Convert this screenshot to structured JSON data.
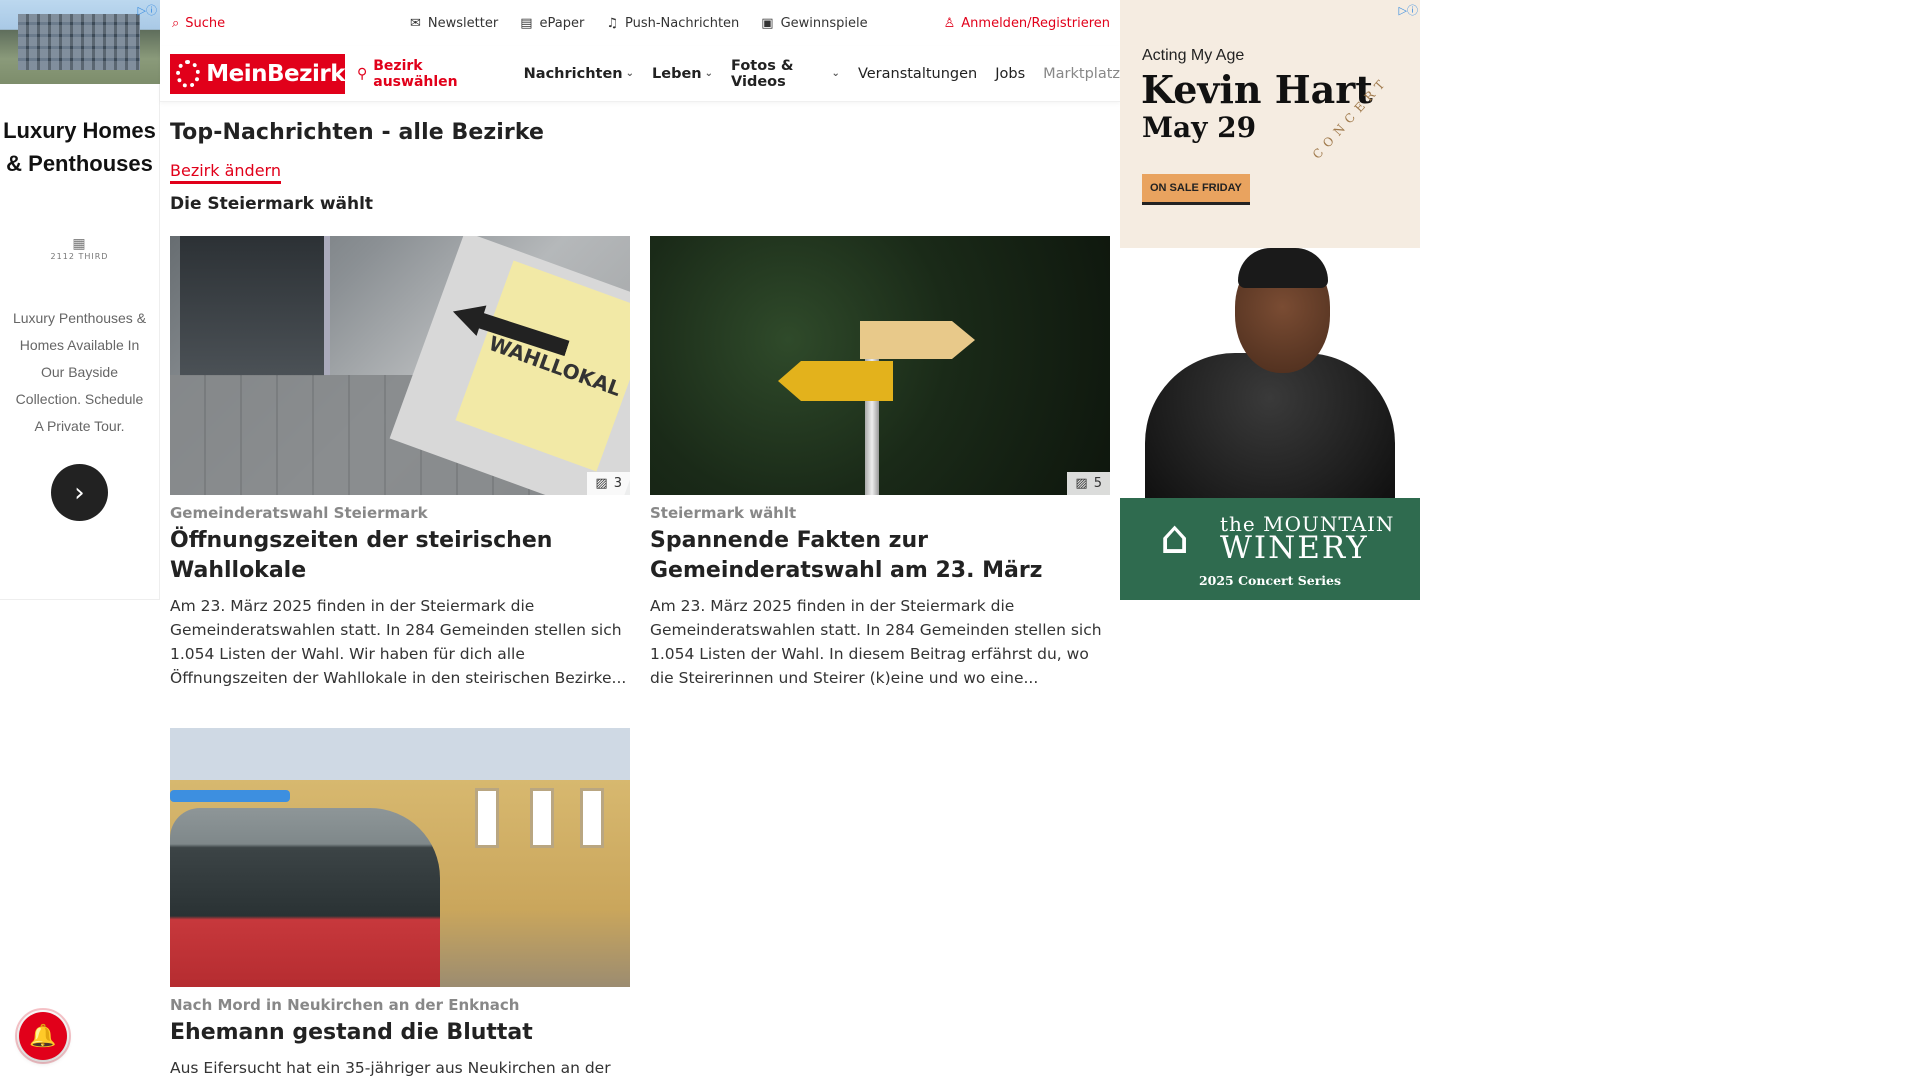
{
  "ads": {
    "left": {
      "headline": "Luxury Homes & Penthouses",
      "brand": "2112 THIRD",
      "body": "Luxury Penthouses & Homes Available In Our Bayside Collection. Schedule A Private Tour."
    },
    "right": {
      "tagline": "Acting My Age",
      "name": "Kevin Hart",
      "date": "May 29",
      "cta": "ON SALE FRIDAY",
      "side_text": "CONCERT",
      "venue_prefix": "the MOUNTAIN",
      "venue": "WINERY",
      "series": "2025 Concert Series"
    }
  },
  "header": {
    "search_label": "Suche",
    "links": [
      {
        "label": "Newsletter",
        "icon": "mail-icon"
      },
      {
        "label": "ePaper",
        "icon": "newspaper-icon"
      },
      {
        "label": "Push-Nachrichten",
        "icon": "bell-icon"
      },
      {
        "label": "Gewinnspiele",
        "icon": "gift-icon"
      }
    ],
    "login_label": "Anmelden/Registrieren"
  },
  "nav": {
    "logo": "MeinBezirk",
    "pick_district": "Bezirk auswählen",
    "items": [
      {
        "label": "Nachrichten",
        "dropdown": true
      },
      {
        "label": "Leben",
        "dropdown": true
      },
      {
        "label": "Fotos & Videos",
        "dropdown": true
      },
      {
        "label": "Veranstaltungen",
        "dropdown": false
      },
      {
        "label": "Jobs",
        "dropdown": false
      },
      {
        "label": "Marktplatz",
        "dropdown": false
      }
    ]
  },
  "page": {
    "title": "Top-Nachrichten - alle Bezirke",
    "change_district": "Bezirk ändern",
    "section": "Die Steiermark wählt"
  },
  "articles": [
    {
      "kicker": "Gemeinderatswahl Steiermark",
      "headline": "Öffnungszeiten der steirischen Wahllokale",
      "teaser": "Am 23. März 2025 finden in der Steiermark die Gemeinderatswahlen statt. In 284 Gemeinden stellen sich 1.054 Listen der Wahl. Wir haben für dich alle Öffnungszeiten der Wahllokale in den steirischen Bezirke...",
      "image_count": "3",
      "image_text": "WAHLLOKAL"
    },
    {
      "kicker": "Steiermark wählt",
      "headline": "Spannende Fakten zur Gemeinderatswahl am 23. März",
      "teaser": "Am 23. März 2025 finden in der Steiermark die Gemeinderatswahlen statt. In 284 Gemeinden stellen sich 1.054 Listen der Wahl. In diesem Beitrag erfährst du, wo die Steirerinnen und Steirer (k)eine und wo eine...",
      "image_count": "5"
    },
    {
      "kicker": "Nach Mord in Neukirchen an der Enknach",
      "headline": "Ehemann gestand die Bluttat",
      "teaser": "Aus Eifersucht hat ein 35-jähriger aus Neukirchen an der"
    }
  ],
  "colors": {
    "brand": "#e1001a"
  }
}
